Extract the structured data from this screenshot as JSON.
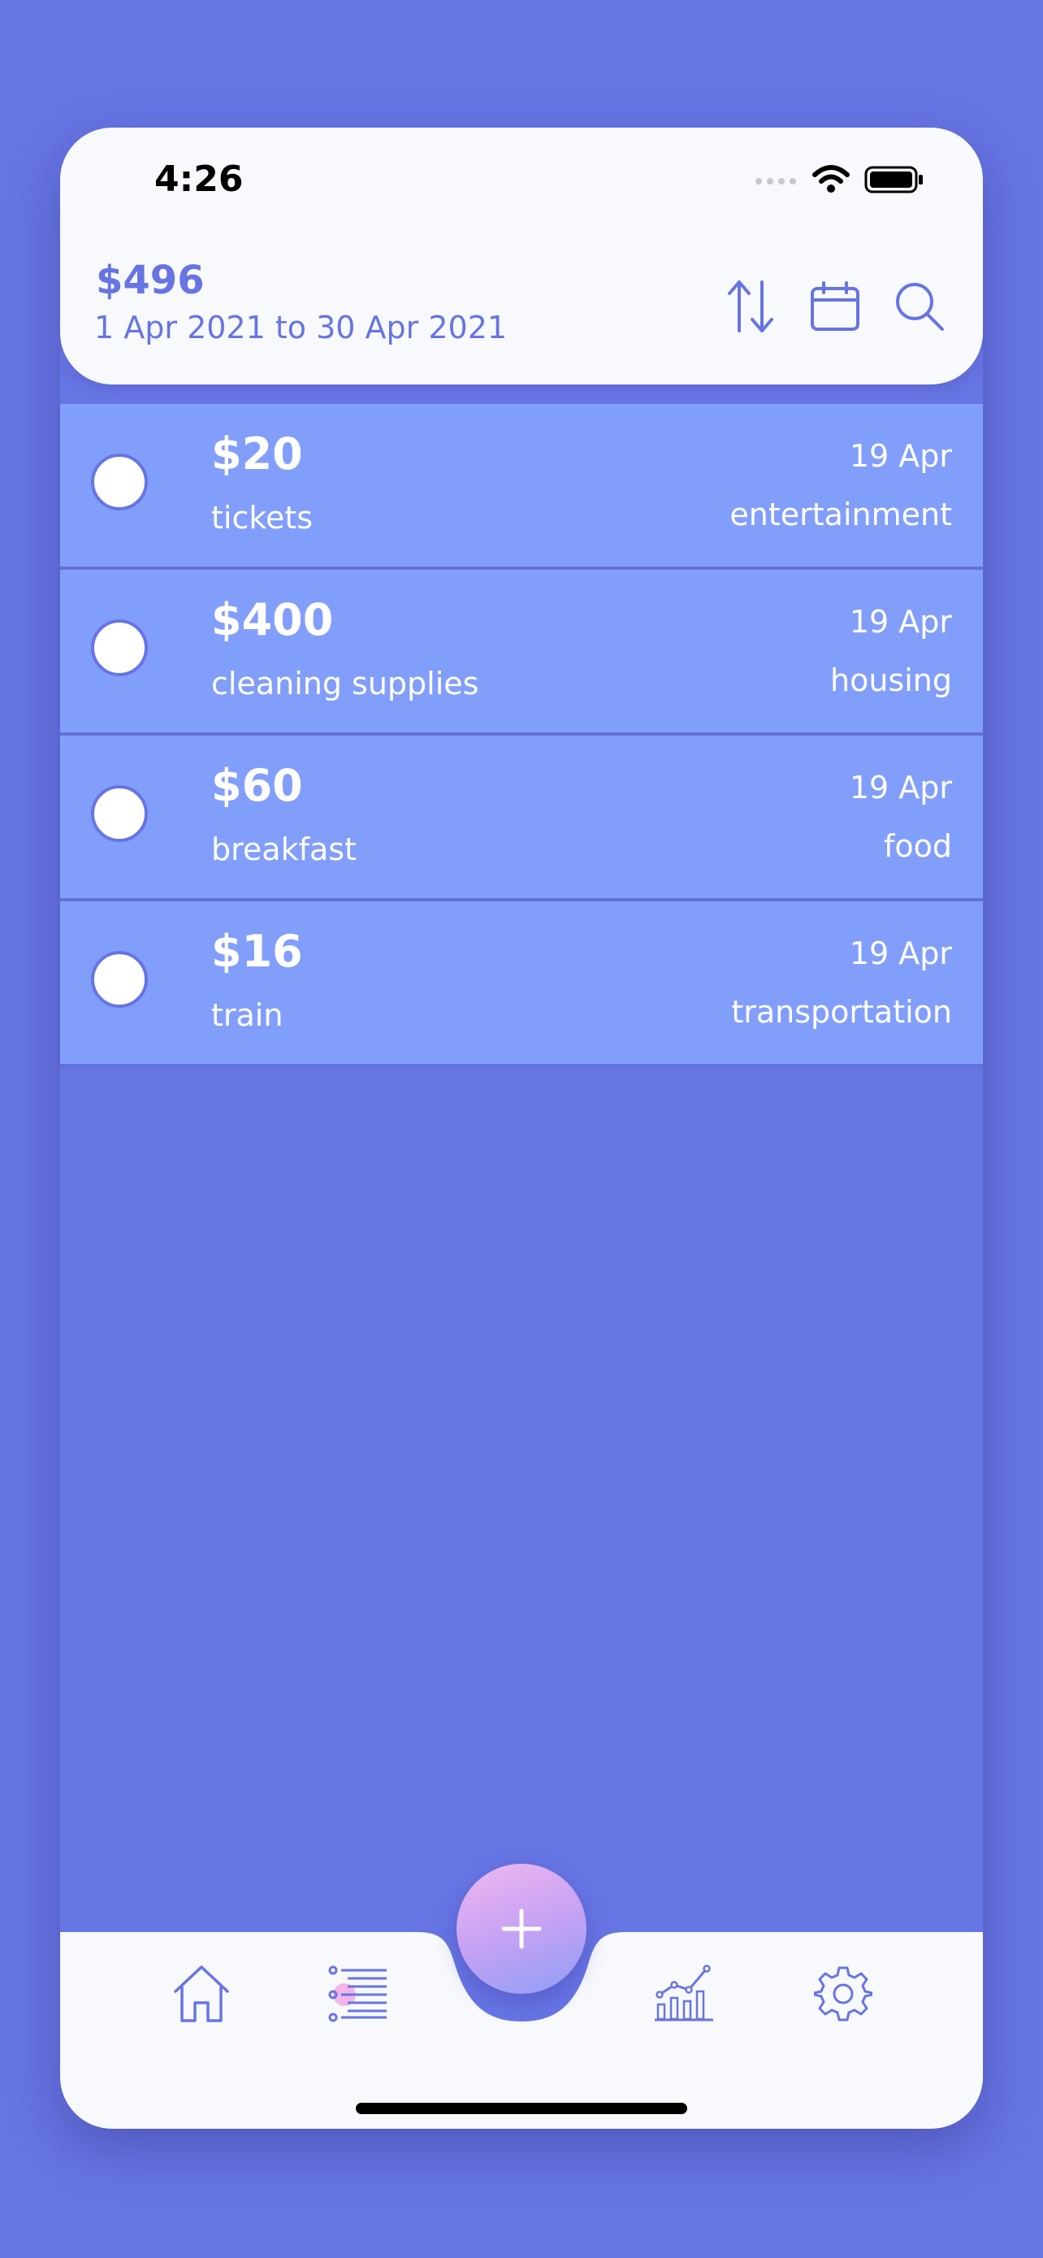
{
  "status_bar": {
    "time": "4:26"
  },
  "header": {
    "total": "$496",
    "date_range": "1 Apr 2021 to 30 Apr 2021",
    "icons": [
      "sort-icon",
      "calendar-icon",
      "search-icon"
    ]
  },
  "expenses": [
    {
      "amount": "$20",
      "label": "tickets",
      "date": "19 Apr",
      "category": "entertainment"
    },
    {
      "amount": "$400",
      "label": "cleaning supplies",
      "date": "19 Apr",
      "category": "housing"
    },
    {
      "amount": "$60",
      "label": "breakfast",
      "date": "19 Apr",
      "category": "food"
    },
    {
      "amount": "$16",
      "label": "train",
      "date": "19 Apr",
      "category": "transportation"
    }
  ],
  "nav": {
    "items": [
      "home-icon",
      "list-icon",
      "add-icon",
      "stats-icon",
      "settings-icon"
    ],
    "active": "list-icon"
  },
  "colors": {
    "background": "#6774e3",
    "row": "#829efb",
    "surface": "#f8f9fd",
    "accent": "#6774e3"
  }
}
